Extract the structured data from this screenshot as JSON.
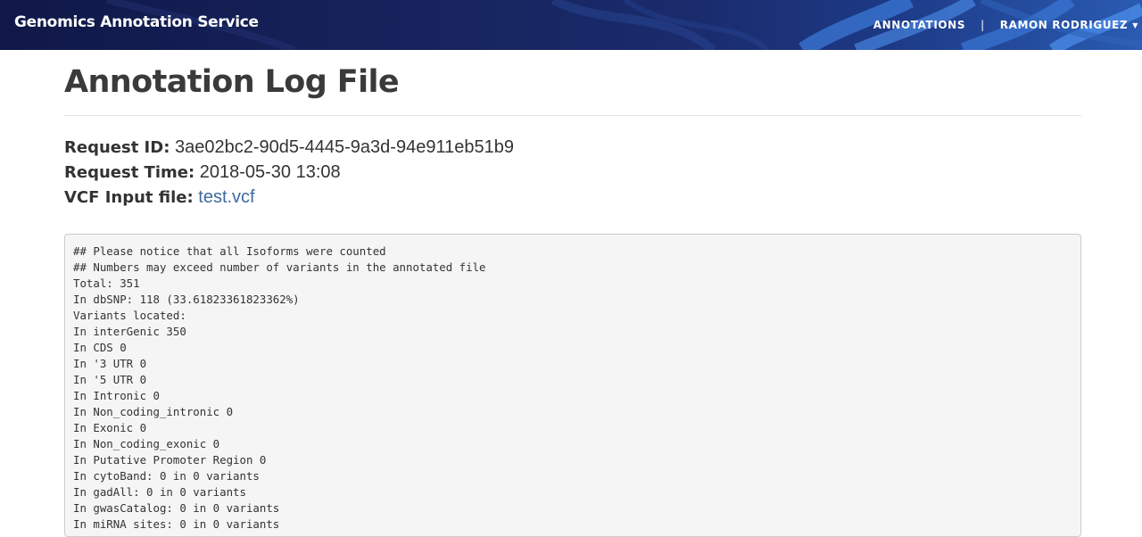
{
  "navbar": {
    "brand": "Genomics Annotation Service",
    "links": {
      "annotations": "ANNOTATIONS",
      "separator": "|",
      "user": "RAMON RODRIGUEZ"
    },
    "colors": {
      "background": "#17245e",
      "helix": "#3b78d6"
    }
  },
  "page": {
    "title": "Annotation Log File",
    "request_id_label": "Request ID:",
    "request_id": "3ae02bc2-90d5-4445-9a3d-94e911eb51b9",
    "request_time_label": "Request Time:",
    "request_time": "2018-05-30 13:08",
    "vcf_label": "VCF Input file:",
    "vcf_file": "test.vcf"
  },
  "log_lines": [
    "## Please notice that all Isoforms were counted",
    "## Numbers may exceed number of variants in the annotated file",
    "Total: 351",
    "In dbSNP: 118 (33.61823361823362%)",
    "Variants located:",
    "In interGenic 350",
    "In CDS 0",
    "In '3 UTR 0",
    "In '5 UTR 0",
    "In Intronic 0",
    "In Non_coding_intronic 0",
    "In Exonic 0",
    "In Non_coding_exonic 0",
    "In Putative Promoter Region 0",
    "In cytoBand: 0 in 0 variants",
    "In gadAll: 0 in 0 variants",
    "In gwasCatalog: 0 in 0 variants",
    "In miRNA sites: 0 in 0 variants"
  ]
}
